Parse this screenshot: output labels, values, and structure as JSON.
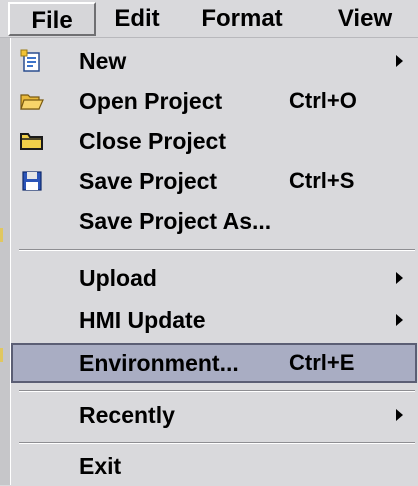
{
  "menubar": {
    "items": [
      {
        "label": "File"
      },
      {
        "label": "Edit"
      },
      {
        "label": "Format"
      },
      {
        "label": "View"
      }
    ]
  },
  "file_menu": {
    "new": {
      "label": "New",
      "icon": "new-project-icon",
      "has_submenu": true
    },
    "open_project": {
      "label": "Open Project",
      "shortcut": "Ctrl+O",
      "icon": "open-folder-icon"
    },
    "close_project": {
      "label": "Close Project",
      "icon": "folder-icon"
    },
    "save_project": {
      "label": "Save Project",
      "shortcut": "Ctrl+S",
      "icon": "floppy-disk-icon"
    },
    "save_project_as": {
      "label": "Save Project As..."
    },
    "upload": {
      "label": "Upload",
      "has_submenu": true
    },
    "hmi_update": {
      "label": "HMI Update",
      "has_submenu": true
    },
    "environment": {
      "label": "Environment...",
      "shortcut": "Ctrl+E",
      "highlighted": true
    },
    "recently": {
      "label": "Recently",
      "has_submenu": true
    },
    "exit": {
      "label": "Exit"
    }
  },
  "colors": {
    "menu_background": "#d9d9dc",
    "highlight_fill": "#a9adc3",
    "highlight_border": "#5b5e74"
  }
}
